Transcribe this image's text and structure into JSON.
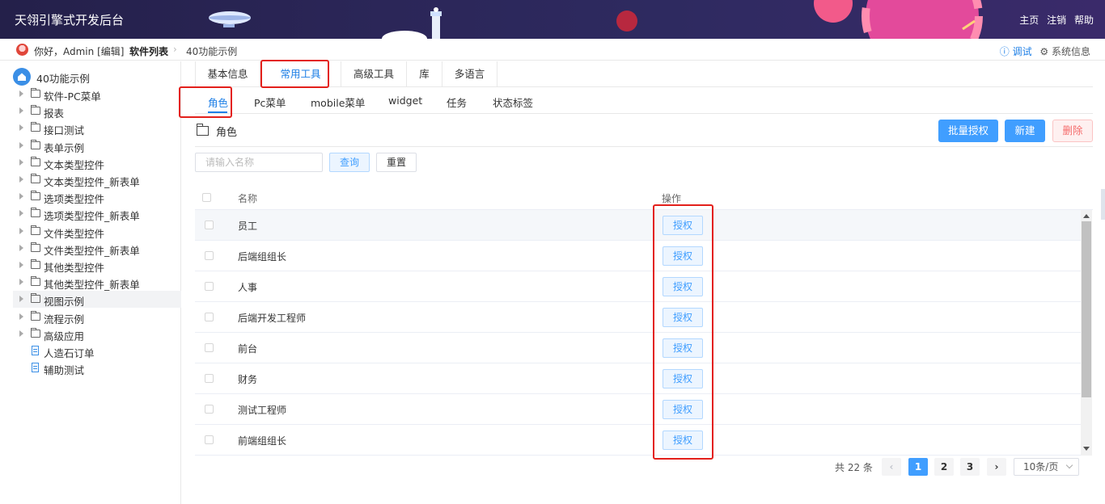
{
  "header": {
    "title": "天翎引擎式开发后台",
    "links": [
      "主页",
      "注销",
      "帮助"
    ]
  },
  "crumbbar": {
    "greeting": "你好，Admin",
    "edit": "[编辑]",
    "crumb_root": "软件列表",
    "crumb_current": "40功能示例",
    "debug": "调试",
    "sysinfo": "系统信息"
  },
  "sidebar": {
    "root": "40功能示例",
    "items": [
      {
        "label": "软件-PC菜单",
        "type": "folder"
      },
      {
        "label": "报表",
        "type": "folder"
      },
      {
        "label": "接口测试",
        "type": "folder"
      },
      {
        "label": "表单示例",
        "type": "folder"
      },
      {
        "label": "文本类型控件",
        "type": "folder"
      },
      {
        "label": "文本类型控件_新表单",
        "type": "folder"
      },
      {
        "label": "选项类型控件",
        "type": "folder"
      },
      {
        "label": "选项类型控件_新表单",
        "type": "folder"
      },
      {
        "label": "文件类型控件",
        "type": "folder"
      },
      {
        "label": "文件类型控件_新表单",
        "type": "folder"
      },
      {
        "label": "其他类型控件",
        "type": "folder"
      },
      {
        "label": "其他类型控件_新表单",
        "type": "folder"
      },
      {
        "label": "视图示例",
        "type": "folder",
        "active": true
      },
      {
        "label": "流程示例",
        "type": "folder"
      },
      {
        "label": "高级应用",
        "type": "folder"
      },
      {
        "label": "人造石订单",
        "type": "doc"
      },
      {
        "label": "辅助测试",
        "type": "doc"
      }
    ]
  },
  "tabs_primary": [
    "基本信息",
    "常用工具",
    "高级工具",
    "库",
    "多语言"
  ],
  "tabs_primary_active": "常用工具",
  "tabs_secondary": [
    "角色",
    "Pc菜单",
    "mobile菜单",
    "widget",
    "任务",
    "状态标签"
  ],
  "tabs_secondary_active": "角色",
  "section": {
    "title": "角色",
    "batch_grant": "批量授权",
    "new": "新建",
    "delete": "删除"
  },
  "search": {
    "placeholder": "请输入名称",
    "query": "查询",
    "reset": "重置"
  },
  "table": {
    "columns": [
      "名称",
      "操作"
    ],
    "rows": [
      {
        "name": "员工",
        "action": "授权"
      },
      {
        "name": "后端组组长",
        "action": "授权"
      },
      {
        "name": "人事",
        "action": "授权"
      },
      {
        "name": "后端开发工程师",
        "action": "授权"
      },
      {
        "name": "前台",
        "action": "授权"
      },
      {
        "name": "财务",
        "action": "授权"
      },
      {
        "name": "测试工程师",
        "action": "授权"
      },
      {
        "name": "前端组组长",
        "action": "授权"
      }
    ]
  },
  "pagination": {
    "total": "共 22 条",
    "pages": [
      "1",
      "2",
      "3"
    ],
    "current": "1",
    "page_size": "10条/页"
  },
  "colors": {
    "accent": "#409eff",
    "highlight_box": "#e3201b",
    "header_bg": "#2b2658"
  }
}
